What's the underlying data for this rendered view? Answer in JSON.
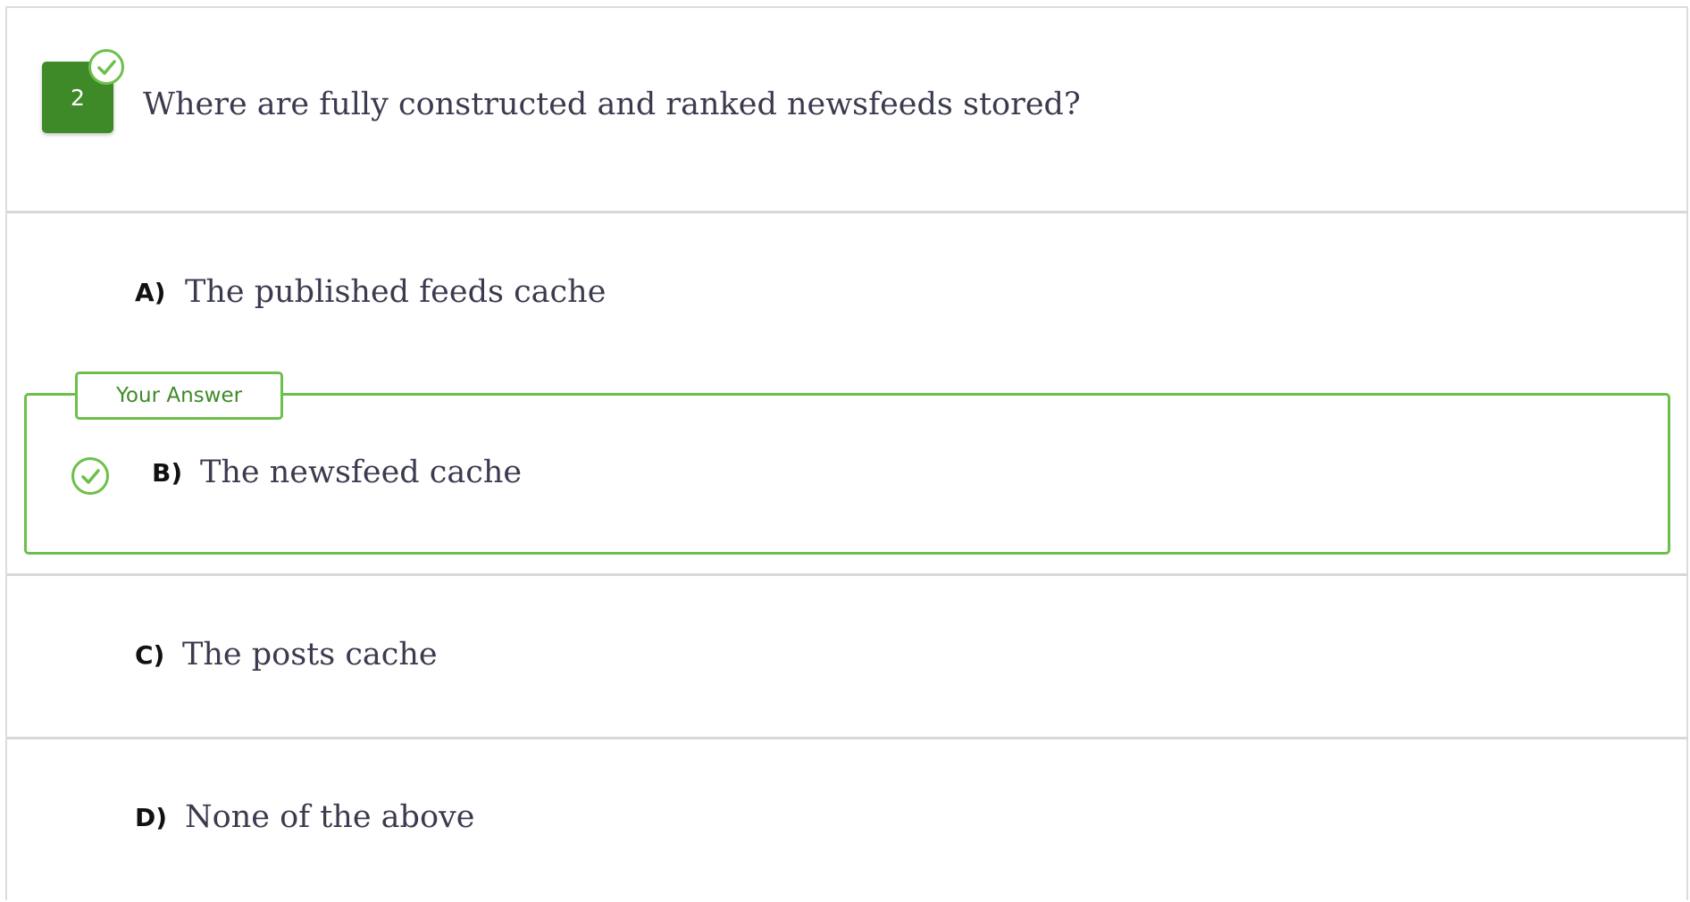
{
  "question": {
    "number": "2",
    "text": "Where are fully constructed and ranked newsfeeds stored?",
    "status_icon": "check-circle-icon"
  },
  "answer_tag": "Your Answer",
  "options": [
    {
      "letter": "A)",
      "text": "The published feeds cache",
      "selected": false
    },
    {
      "letter": "B)",
      "text": "The newsfeed cache",
      "selected": true
    },
    {
      "letter": "C)",
      "text": "The posts cache",
      "selected": false
    },
    {
      "letter": "D)",
      "text": "None of the above",
      "selected": false
    }
  ],
  "colors": {
    "badge": "#3f8a28",
    "correct_accent": "#6cc04a",
    "text": "#3b3b4f",
    "divider": "#d8d8d8"
  }
}
